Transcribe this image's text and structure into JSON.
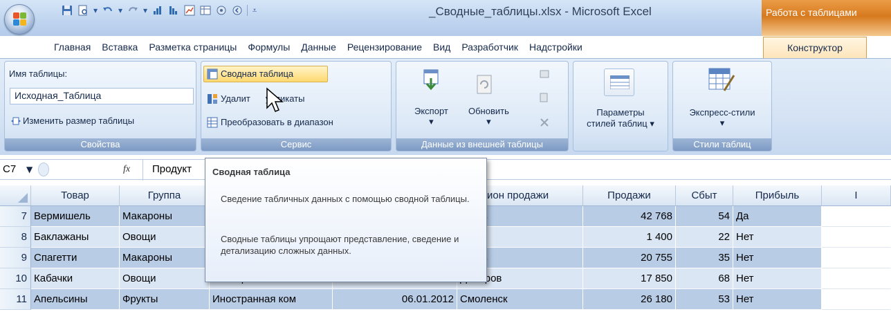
{
  "window": {
    "title": "_Сводные_таблицы.xlsx - Microsoft Excel",
    "context_title": "Работа с таблицами"
  },
  "quick_access": [
    "save-icon",
    "print-preview-icon",
    "undo-icon",
    "redo-icon",
    "sort-asc-icon",
    "sort-desc-icon",
    "chart-icon",
    "table-icon",
    "circle-icon",
    "back-icon"
  ],
  "tabs": [
    "Главная",
    "Вставка",
    "Разметка страницы",
    "Формулы",
    "Данные",
    "Рецензирование",
    "Вид",
    "Разработчик",
    "Надстройки"
  ],
  "active_tab": "Конструктор",
  "ribbon": {
    "properties": {
      "label": "Свойства",
      "name_label": "Имя таблицы:",
      "name_value": "Исходная_Таблица",
      "resize": "Изменить размер таблицы"
    },
    "service": {
      "label": "Сервис",
      "pivot": "Сводная таблица",
      "remove_dup_a": "Удалит",
      "remove_dup_b": "убликаты",
      "convert": "Преобразовать в диапазон"
    },
    "external": {
      "label": "Данные из внешней таблицы",
      "export": "Экспорт",
      "refresh": "Обновить"
    },
    "style_params": {
      "label_line1": "Параметры",
      "label_line2": "стилей таблиц"
    },
    "styles": {
      "label": "Стили таблиц",
      "express": "Экспресс-стили"
    }
  },
  "formula_bar": {
    "cell": "C7",
    "fx": "fx",
    "value": "Продукт"
  },
  "tooltip": {
    "title": "Сводная таблица",
    "p1": "Сведение табличных данных с помощью сводной таблицы.",
    "p2": "Сводные таблицы упрощают представление, сведение и детализацию сложных данных."
  },
  "headers": [
    "Товар",
    "Группа",
    "",
    "",
    "ион продажи",
    "Продажи",
    "Сбыт",
    "Прибыль",
    "I"
  ],
  "rows": [
    {
      "n": "7",
      "c": [
        "Вермишель",
        "Макароны",
        "",
        "",
        "итров",
        "42 768",
        "54",
        "Да"
      ]
    },
    {
      "n": "8",
      "c": [
        "Баклажаны",
        "Овощи",
        "",
        "",
        "сква",
        "1 400",
        "22",
        "Нет"
      ]
    },
    {
      "n": "9",
      "c": [
        "Спагетти",
        "Макароны",
        "",
        "",
        "итров",
        "20 755",
        "35",
        "Нет"
      ]
    },
    {
      "n": "10",
      "c": [
        "Кабачки",
        "Овощи",
        "Иностранная ком",
        "21.10.2011",
        "Дмитров",
        "17 850",
        "68",
        "Нет"
      ]
    },
    {
      "n": "11",
      "c": [
        "Апельсины",
        "Фрукты",
        "Иностранная ком",
        "06.01.2012",
        "Смоленск",
        "26 180",
        "53",
        "Нет"
      ]
    }
  ],
  "colors": {
    "band_dark": "#b8cce6",
    "band_light": "#dbe6f4",
    "accent_orange": "#d77a1f"
  }
}
